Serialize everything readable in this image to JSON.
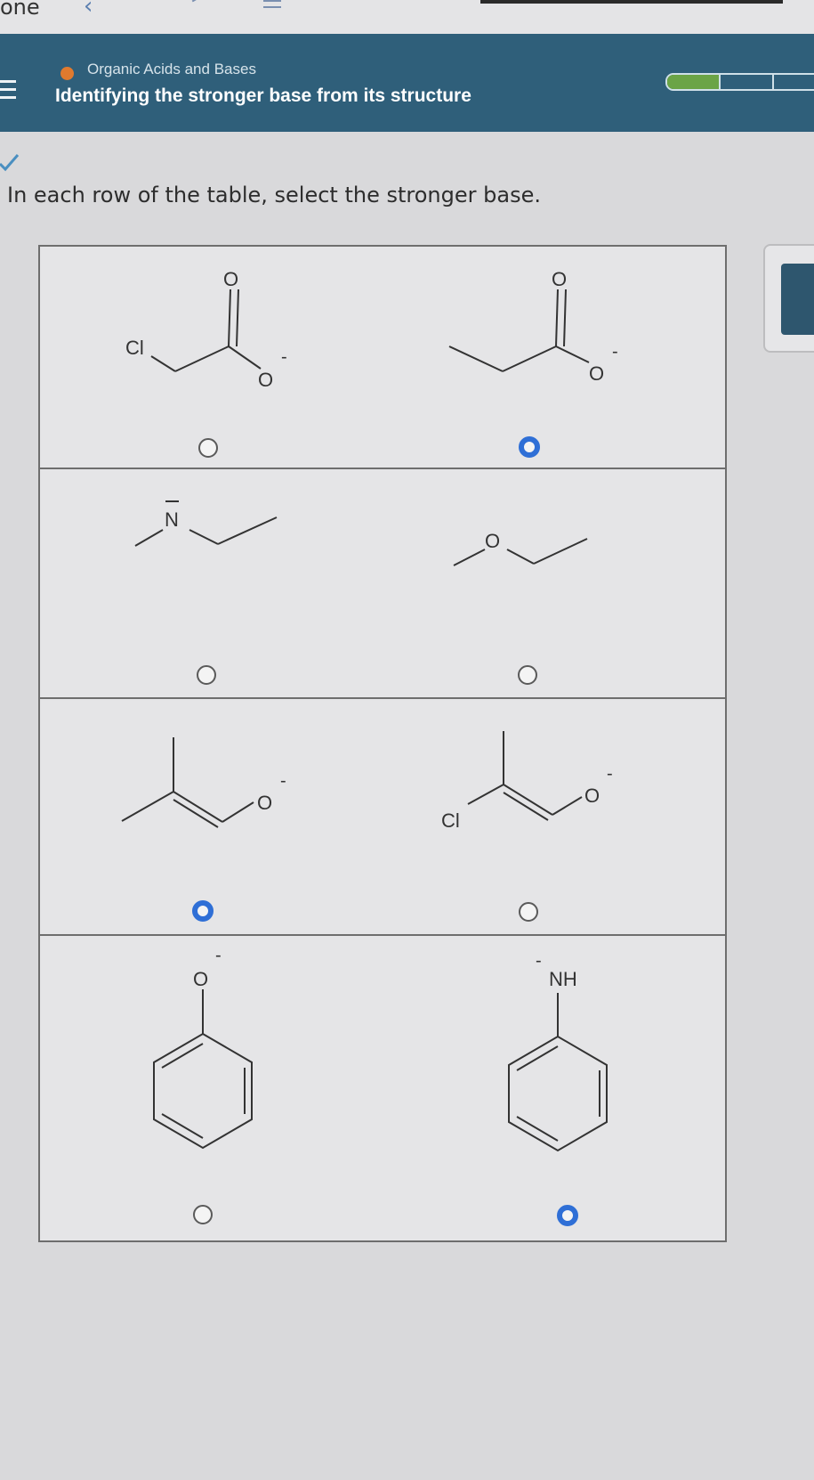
{
  "statusbar": {
    "carrier": "one"
  },
  "header": {
    "topic": "Organic Acids and Bases",
    "title": "Identifying the stronger base from its structure",
    "progress_total_segments": 3,
    "progress_completed_segments": 1,
    "colors": {
      "banner": "#2f5f7a",
      "topic_dot": "#e07a2e",
      "progress": "#6ba446"
    }
  },
  "instruction": "In each row of the table, select the stronger base.",
  "rows": [
    {
      "left": {
        "labels": {
          "cl": "Cl",
          "o_carbonyl": "O",
          "o_anion": "O",
          "charge": "-"
        },
        "selected": false
      },
      "right": {
        "labels": {
          "o_carbonyl": "O",
          "o_anion": "O",
          "charge": "-"
        },
        "selected": true
      }
    },
    {
      "left": {
        "labels": {
          "n": "N"
        },
        "selected": false
      },
      "right": {
        "labels": {
          "o": "O"
        },
        "selected": false
      }
    },
    {
      "left": {
        "labels": {
          "o_anion": "O",
          "charge": "-"
        },
        "selected": true
      },
      "right": {
        "labels": {
          "cl": "Cl",
          "o_anion": "O",
          "charge": "-"
        },
        "selected": false
      }
    },
    {
      "left": {
        "labels": {
          "o_anion": "O",
          "charge": "-"
        },
        "selected": false
      },
      "right": {
        "labels": {
          "nh": "NH",
          "charge": "-"
        },
        "selected": true
      }
    }
  ],
  "selected_color": "#2f6fd6"
}
